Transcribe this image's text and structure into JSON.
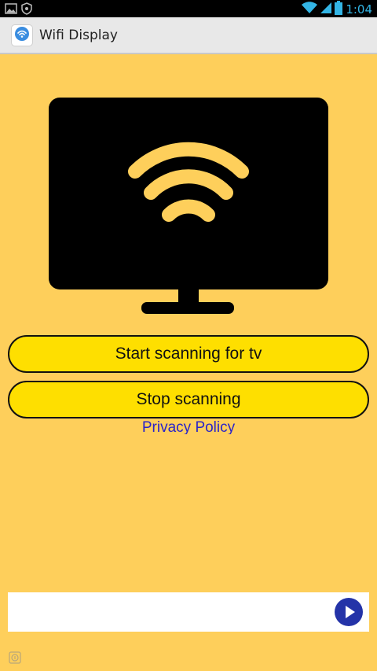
{
  "status_bar": {
    "time": "1:04",
    "icons": [
      "gallery-icon",
      "shield-icon",
      "wifi-icon",
      "cell-signal-icon",
      "battery-icon"
    ]
  },
  "app": {
    "title": "Wifi Display",
    "icon": "wifi-icon"
  },
  "illustration": {
    "name": "tv-wifi-illustration",
    "screen_color": "#000000",
    "wave_color": "#fecf5b"
  },
  "buttons": {
    "start_label": "Start scanning for tv",
    "stop_label": "Stop scanning"
  },
  "privacy": {
    "label": "Privacy Policy"
  },
  "ad": {
    "play_icon": "play-icon",
    "info_icon": "ad-info-icon"
  },
  "colors": {
    "background": "#fecf5b",
    "button_fill": "#fedf00",
    "link": "#2a23c9",
    "status_accent": "#33b5e5"
  }
}
